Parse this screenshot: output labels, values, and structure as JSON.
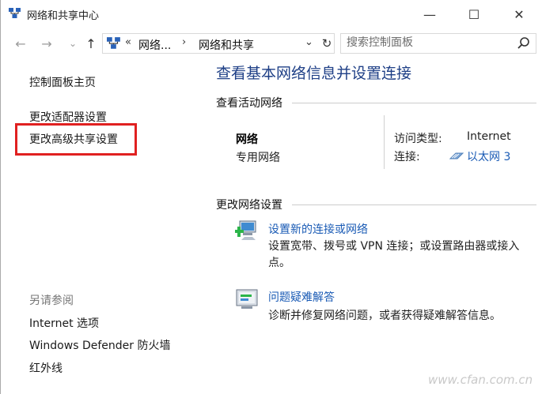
{
  "window": {
    "title": "网络和共享中心",
    "minimize_glyph": "—",
    "maximize_glyph": "☐",
    "close_glyph": "✕"
  },
  "nav": {
    "back_glyph": "←",
    "forward_glyph": "→",
    "recent_glyph": "⌄",
    "up_glyph": "↑",
    "refresh_glyph": "↻",
    "address": {
      "overflow": "«",
      "crumbs": [
        "网络...",
        "网络和共享"
      ],
      "separator": "›",
      "dropdown_glyph": "⌄"
    },
    "search": {
      "placeholder": "搜索控制面板"
    }
  },
  "sidebar": {
    "home": "控制面板主页",
    "items": [
      "更改适配器设置",
      "更改高级共享设置"
    ],
    "see_also_title": "另请参阅",
    "see_also": [
      "Internet 选项",
      "Windows Defender 防火墙",
      "红外线"
    ]
  },
  "main": {
    "title": "查看基本网络信息并设置连接",
    "active_section": "查看活动网络",
    "network": {
      "name": "网络",
      "type": "专用网络",
      "access_label": "访问类型:",
      "access_value": "Internet",
      "connection_label": "连接:",
      "connection_value": "以太网 3"
    },
    "change_section": "更改网络设置",
    "tasks": [
      {
        "icon": "new-connection-icon",
        "title": "设置新的连接或网络",
        "description": "设置宽带、拨号或 VPN 连接；或设置路由器或接入点。"
      },
      {
        "icon": "troubleshoot-icon",
        "title": "问题疑难解答",
        "description": "诊断并修复网络问题，或者获得疑难解答信息。"
      }
    ]
  },
  "watermark": "www.cfan.com.cn",
  "colors": {
    "title_blue": "#1e3f86",
    "link_blue": "#1a5bb5",
    "highlight_red": "#e02020"
  }
}
